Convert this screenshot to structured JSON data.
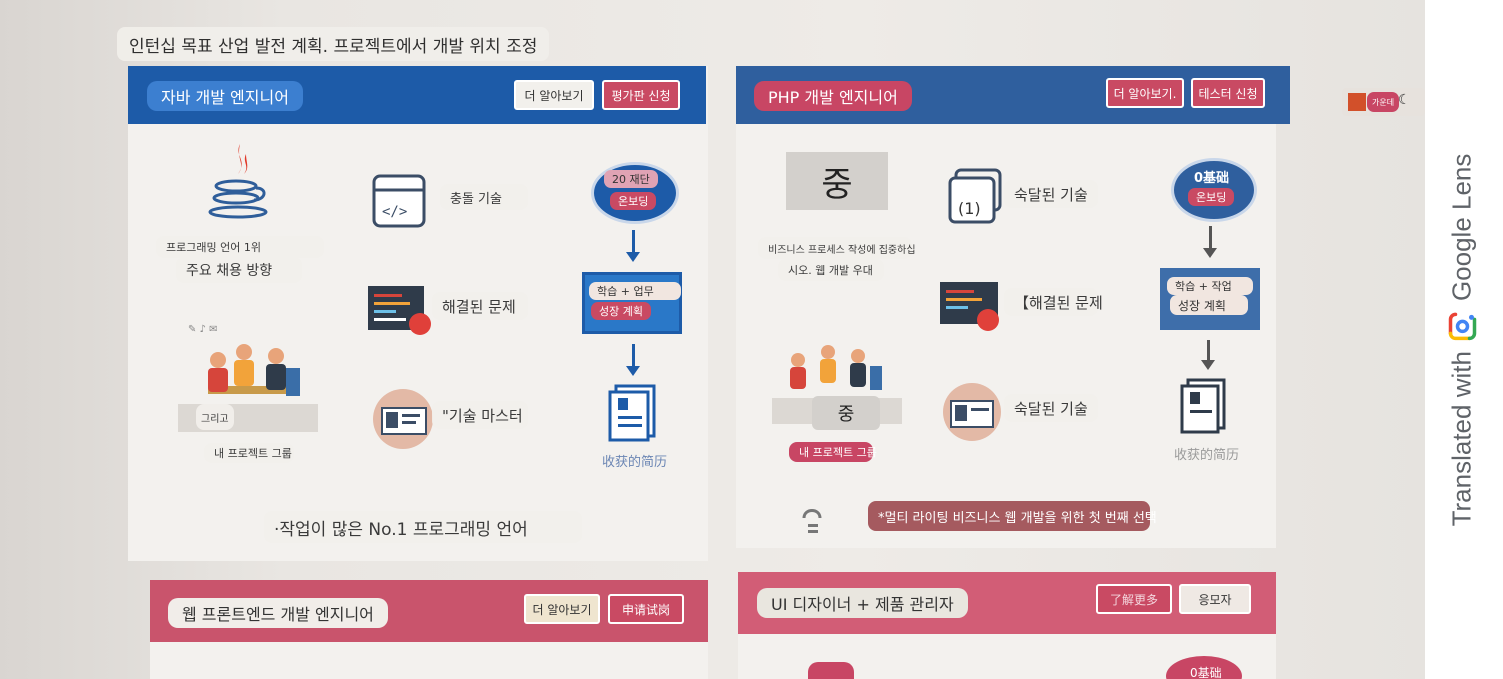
{
  "page_title": "인턴십 목표 산업 발전 계획. 프로젝트에서 개발 위치 조정",
  "java_card": {
    "title": "자바 개발 엔지니어",
    "learn_more": "더 알아보기",
    "apply": "평가판 신청",
    "rank_line": "프로그래밍 언어 1위",
    "direction": "주요 채용 방향",
    "feature_1": "충돌 기술",
    "feature_2": "해결된 문제",
    "feature_3": "\"기술 마스터",
    "and_label": "그리고",
    "group_label": "내 프로젝트 그룹",
    "badge_top": "20 재단",
    "badge_bottom": "온보딩",
    "plan_top": "학습 + 업무",
    "plan_bottom": "성장 계획",
    "resume_label": "收获的简历",
    "footer": "·작업이 많은 No.1 프로그래밍 언어"
  },
  "php_card": {
    "title": "PHP 개발 엔지니어",
    "learn_more": "더 알아보기.",
    "apply": "테스터 신청",
    "big_char": "중",
    "line_1": "비즈니스 프로세스 작성에 집중하십",
    "line_2": "시오. 웹 개발 우대",
    "feature_1": "숙달된 기술",
    "feature_1_icon_label": "(1)",
    "feature_2": "【해결된 문제",
    "feature_3": "숙달된 기술",
    "mid_char": "중",
    "group_label": "내 프로젝트 그룹",
    "badge_top": "0基础",
    "badge_bottom": "온보딩",
    "plan_top": "학습 + 작업",
    "plan_bottom": "성장 계획",
    "resume_label": "收获的简历",
    "footer": "*멀티 라이팅 비즈니스 웹 개발을 위한 첫 번째 선택"
  },
  "frontend_card": {
    "title": "웹 프론트엔드 개발 엔지니어",
    "learn_more": "더 알아보기",
    "apply": "申请试岗"
  },
  "ui_card": {
    "title": "UI 디자이너 + 제품 관리자",
    "learn_more": "了解更多",
    "apply": "응모자",
    "badge_top": "0基础"
  },
  "side_widget_label": "가운데",
  "lens": {
    "prefix": "Translated with",
    "brand": "Google Lens"
  },
  "colors": {
    "blue": "#1d5ba8",
    "red": "#c84664"
  }
}
